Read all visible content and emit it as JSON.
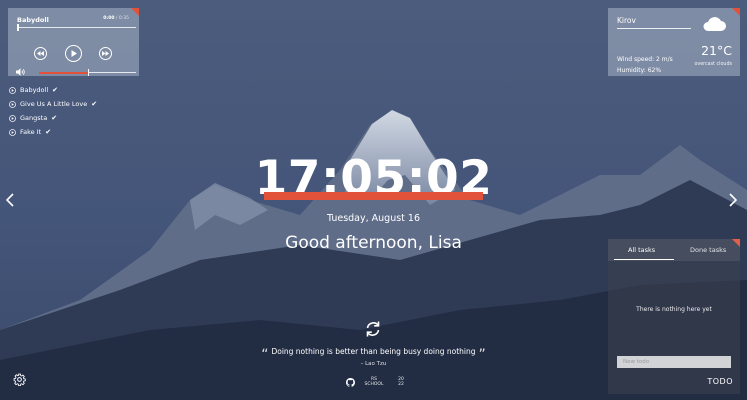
{
  "player": {
    "track_title": "Babydoll",
    "current_time": "0:00",
    "total_time": "0:35",
    "progress": 0.0,
    "volume": 0.5,
    "playlist": [
      {
        "title": "Babydoll"
      },
      {
        "title": "Give Us A Little Love"
      },
      {
        "title": "Gangsta"
      },
      {
        "title": "Fake It"
      }
    ]
  },
  "weather": {
    "city": "Kirov",
    "wind": "Wind speed: 2 m/s",
    "humidity": "Humidity: 62%",
    "temperature": "21°C",
    "condition": "overcast clouds",
    "icon": "cloud-icon"
  },
  "clock": {
    "time": "17:05:02",
    "date": "Tuesday, August 16",
    "greeting": "Good afternoon, Lisa"
  },
  "quote": {
    "text": "Doing nothing is better than being busy doing nothing",
    "author": "– Lao Tzu"
  },
  "footer": {
    "github_icon": "github-icon",
    "rs_logo": "RS",
    "rs_logo_line2": "SCHOOL",
    "year": "20",
    "year_line2": "22"
  },
  "todo": {
    "tab_all": "All tasks",
    "tab_done": "Done tasks",
    "empty_text": "There is nothing here yet",
    "input_placeholder": "New todo",
    "label": "TODO"
  },
  "colors": {
    "accent": "#e2523a",
    "panel": "#bec8d7"
  }
}
